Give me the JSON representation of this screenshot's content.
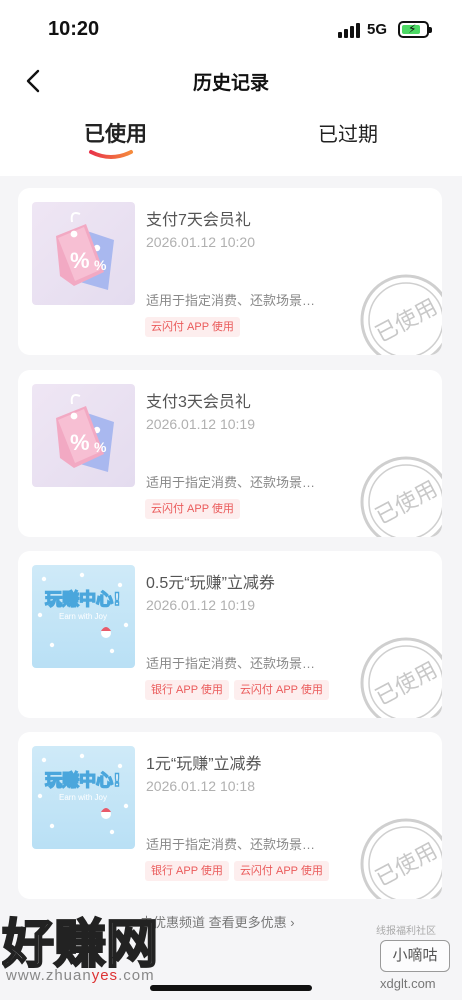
{
  "status_bar": {
    "time": "10:20",
    "network": "5G"
  },
  "nav": {
    "title": "历史记录"
  },
  "tabs": [
    {
      "label": "已使用",
      "active": true
    },
    {
      "label": "已过期",
      "active": false
    }
  ],
  "coupons": [
    {
      "title": "支付7天会员礼",
      "date": "2026.01.12 10:20",
      "desc": "适用于指定消费、还款场景…",
      "badges": [
        "云闪付 APP 使用"
      ],
      "image": "tag-percent-icon",
      "stamp": "已使用"
    },
    {
      "title": "支付3天会员礼",
      "date": "2026.01.12 10:19",
      "desc": "适用于指定消费、还款场景…",
      "badges": [
        "云闪付 APP 使用"
      ],
      "image": "tag-percent-icon",
      "stamp": "已使用"
    },
    {
      "title": "0.5元“玩赚”立减券",
      "date": "2026.01.12 10:19",
      "desc": "适用于指定消费、还款场景…",
      "badges": [
        "银行 APP 使用",
        "云闪付 APP 使用"
      ],
      "image": "play-earn-center-logo",
      "stamp": "已使用"
    },
    {
      "title": "1元“玩赚”立减券",
      "date": "2026.01.12 10:18",
      "desc": "适用于指定消费、还款场景…",
      "badges": [
        "银行 APP 使用",
        "云闪付 APP 使用"
      ],
      "image": "play-earn-center-logo",
      "stamp": "已使用"
    }
  ],
  "play_logo": {
    "title": "玩赚中心!",
    "subtitle": "Earn with Joy"
  },
  "footer": {
    "link": "去优惠频道 查看更多优惠 ›"
  },
  "watermark": {
    "left_big": "好赚网",
    "left_url_a": "www.zhuan",
    "left_url_hl": "yes",
    "left_url_b": ".com",
    "right_top": "线报福利社区",
    "right_badge": "小嘀咕",
    "right_url": "xdglt.com"
  },
  "colors": {
    "accent": "#ea5a5a",
    "stamp": "#cfcfcf",
    "background": "#f5f5f7"
  }
}
